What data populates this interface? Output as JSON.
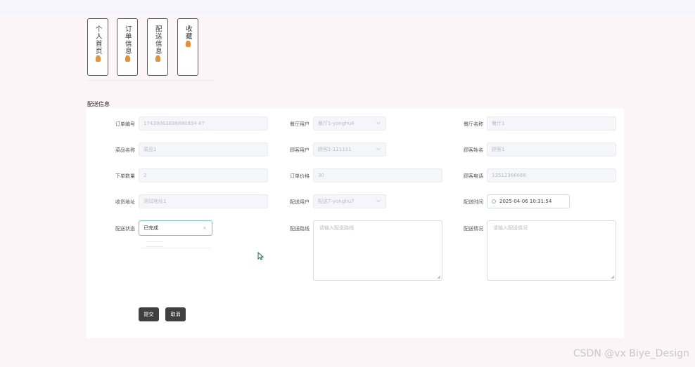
{
  "nav": {
    "tiles": [
      {
        "label": "个人首页",
        "icon": "shopping-bag-icon"
      },
      {
        "label": "订单信息",
        "icon": "shopping-bag-icon"
      },
      {
        "label": "配送信息",
        "icon": "shopping-bag-icon"
      },
      {
        "label": "收藏",
        "icon": "shopping-bag-icon"
      }
    ]
  },
  "section": {
    "title": "配送信息"
  },
  "form": {
    "order_no": {
      "label": "订单编号",
      "value": "17439063896880934 47"
    },
    "restaurant_user": {
      "label": "餐厅用户",
      "value": "餐厅1-yonghu4"
    },
    "restaurant_name": {
      "label": "餐厅名称",
      "value": "餐厅1"
    },
    "dish_name": {
      "label": "菜品名称",
      "value": "菜品1"
    },
    "customer_user": {
      "label": "顾客用户",
      "value": "顾客1-111111"
    },
    "customer_name": {
      "label": "顾客姓名",
      "value": "顾客1"
    },
    "quantity": {
      "label": "下单数量",
      "value": "2"
    },
    "order_price": {
      "label": "订单价格",
      "value": "30"
    },
    "customer_phone": {
      "label": "顾客电话",
      "value": "13512366666"
    },
    "address": {
      "label": "收货地址",
      "value": "测试地址1"
    },
    "delivery_user": {
      "label": "配送用户",
      "value": "配送7-yonghu7"
    },
    "delivery_time": {
      "label": "配送时间",
      "value": "2025-04-06 10:31:54"
    },
    "status": {
      "label": "配送状态",
      "value": "已完成"
    },
    "route": {
      "label": "配送路线",
      "placeholder": "请输入配送路线"
    },
    "situation": {
      "label": "配送情况",
      "placeholder": "请输入配送情况"
    }
  },
  "actions": {
    "submit": "提交",
    "cancel": "取消"
  },
  "watermark": "CSDN @vx Biye_Design",
  "colors": {
    "tile_icon": "#e6913a",
    "button": "#404040",
    "focus_border": "#7cc3bf"
  }
}
